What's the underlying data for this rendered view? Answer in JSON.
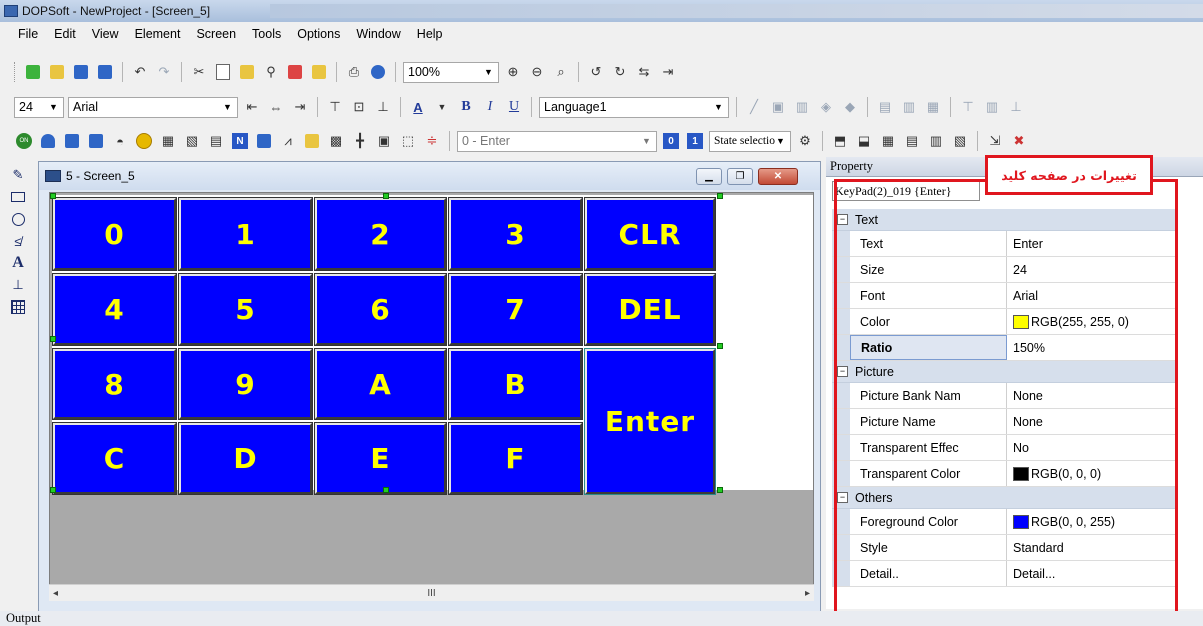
{
  "window": {
    "title": "DOPSoft - NewProject - [Screen_5]"
  },
  "menu": [
    "File",
    "Edit",
    "View",
    "Element",
    "Screen",
    "Tools",
    "Options",
    "Window",
    "Help"
  ],
  "toolbar1": {
    "zoom": "100%"
  },
  "toolbar2": {
    "font_size": "24",
    "font_name": "Arial",
    "language": "Language1"
  },
  "toolbar3": {
    "address": "0 - Enter",
    "state_select": "State selectio",
    "btn0": "0",
    "btn1": "1"
  },
  "screen_window": {
    "title": "5 - Screen_5",
    "scroll_mid": "III"
  },
  "keypad": {
    "keys": [
      "0",
      "1",
      "2",
      "3",
      "CLR",
      "4",
      "5",
      "6",
      "7",
      "DEL",
      "8",
      "9",
      "A",
      "B",
      "Enter",
      "C",
      "D",
      "E",
      "F"
    ],
    "fg": "#ffff00",
    "bg": "#0000ff"
  },
  "property": {
    "header": "Property",
    "selected_object": "KeyPad(2)_019 {Enter}",
    "categories": [
      {
        "name": "Text",
        "rows": [
          {
            "name": "Text",
            "value": "Enter"
          },
          {
            "name": "Size",
            "value": "24"
          },
          {
            "name": "Font",
            "value": "Arial"
          },
          {
            "name": "Color",
            "value": "RGB(255, 255, 0)",
            "swatch": "#ffff00"
          },
          {
            "name": "Ratio",
            "value": "150%",
            "selected": true
          }
        ]
      },
      {
        "name": "Picture",
        "rows": [
          {
            "name": "Picture Bank Nam",
            "value": "None"
          },
          {
            "name": "Picture Name",
            "value": "None"
          },
          {
            "name": "Transparent Effec",
            "value": "No"
          },
          {
            "name": "Transparent Color",
            "value": "RGB(0, 0, 0)",
            "swatch": "#000000"
          }
        ]
      },
      {
        "name": "Others",
        "rows": [
          {
            "name": "Foreground Color",
            "value": "RGB(0, 0, 255)",
            "swatch": "#0000ff"
          },
          {
            "name": "Style",
            "value": "Standard"
          },
          {
            "name": "Detail..",
            "value": "Detail..."
          }
        ]
      }
    ]
  },
  "annotation": {
    "label": "تغییرات در صفحه کلید",
    "color": "#e0161e"
  },
  "output": {
    "label": "Output"
  }
}
